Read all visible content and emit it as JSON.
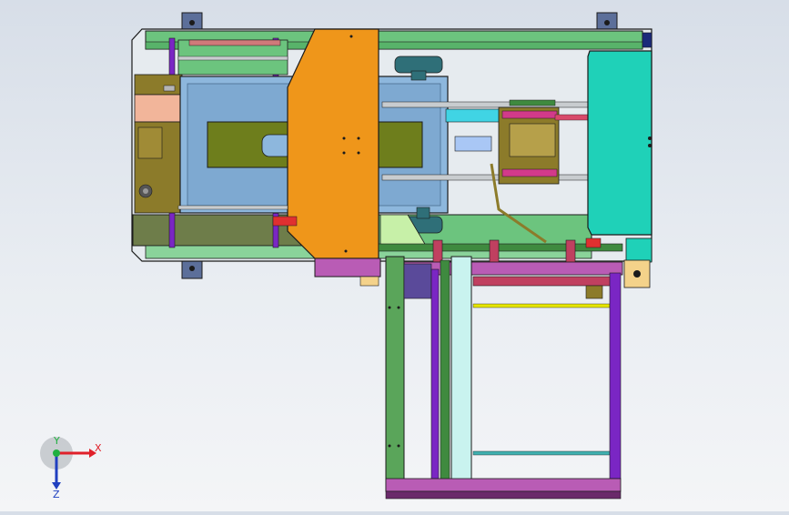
{
  "viewport": {
    "background_top": "#d7dee8",
    "background_bottom": "#f4f5f7"
  },
  "triad": {
    "x_label": "X",
    "y_label": "Y",
    "z_label": "Z",
    "x_color": "#e0202a",
    "y_color": "#20b040",
    "z_color": "#2040c0"
  },
  "colors": {
    "frame_green": "#6cc47e",
    "cover_orange": "#ef961a",
    "tray_blue": "#8db7dd",
    "slot_olive": "#6e7e1c",
    "panel_teal": "#1fd1b8",
    "bracket_purple": "#b95cb5",
    "rail_violet": "#7a26c4",
    "dark_green": "#3f8a3f",
    "block_olive": "#8c7b2a",
    "pink_block": "#f2b59a"
  }
}
